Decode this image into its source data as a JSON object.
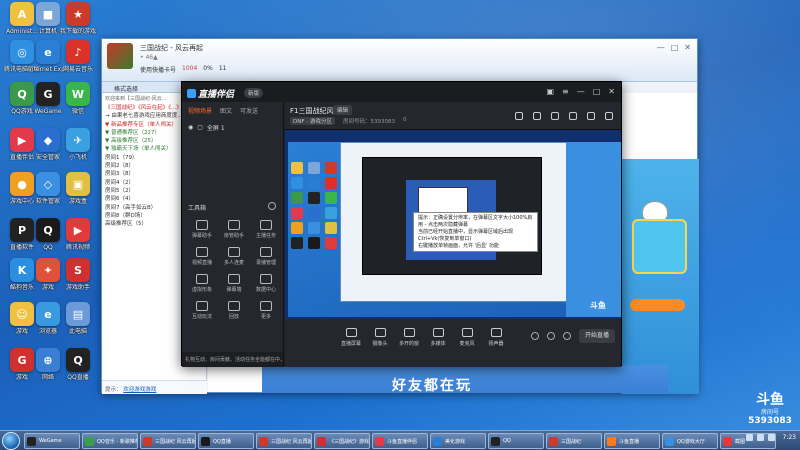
{
  "desktop_icons": [
    {
      "label": "Administ...",
      "color": "#f0c040",
      "glyph": "A"
    },
    {
      "label": "计算机",
      "color": "#7aa6d8",
      "glyph": "■"
    },
    {
      "label": "我下载的游戏",
      "color": "#cc3a2a",
      "glyph": "★"
    },
    {
      "label": "腾讯电脑管家",
      "color": "#2f8fe0",
      "glyph": "◎"
    },
    {
      "label": "Internet Explorer",
      "color": "#2a7fd4",
      "glyph": "e"
    },
    {
      "label": "网易云音乐",
      "color": "#d8322a",
      "glyph": "♪"
    },
    {
      "label": "QQ游戏",
      "color": "#3a9a4a",
      "glyph": "Q"
    },
    {
      "label": "WeGame",
      "color": "#222222",
      "glyph": "G"
    },
    {
      "label": "微信",
      "color": "#3ab54a",
      "glyph": "W"
    },
    {
      "label": "直播伴侣",
      "color": "#e23a4a",
      "glyph": "▶"
    },
    {
      "label": "安全管家",
      "color": "#2a6fd0",
      "glyph": "◆"
    },
    {
      "label": "小飞机",
      "color": "#3aa0e0",
      "glyph": "✈"
    },
    {
      "label": "游戏中心",
      "color": "#f0a020",
      "glyph": "●"
    },
    {
      "label": "软件管家",
      "color": "#3a8fe0",
      "glyph": "◇"
    },
    {
      "label": "游戏盒",
      "color": "#e0c040",
      "glyph": "▣"
    },
    {
      "label": "直播软件",
      "color": "#222222",
      "glyph": "P"
    },
    {
      "label": "QQ",
      "color": "#1a1a1a",
      "glyph": "Q"
    },
    {
      "label": "腾讯视频",
      "color": "#e03a3a",
      "glyph": "▶"
    },
    {
      "label": "酷狗音乐",
      "color": "#2a8fe0",
      "glyph": "K"
    },
    {
      "label": "游戏",
      "color": "#e0503a",
      "glyph": "✦"
    },
    {
      "label": "游戏助手",
      "color": "#d03030",
      "glyph": "S"
    },
    {
      "label": "游戏",
      "color": "#f0c040",
      "glyph": "☺"
    },
    {
      "label": "浏览器",
      "color": "#3a9ae0",
      "glyph": "e"
    },
    {
      "label": "此电脑",
      "color": "#6a9ad8",
      "glyph": "▤"
    },
    {
      "label": "游戏",
      "color": "#d03030",
      "glyph": "G"
    },
    {
      "label": "网络",
      "color": "#3a7fd4",
      "glyph": "⊕"
    },
    {
      "label": "QQ直播",
      "color": "#222222",
      "glyph": "Q"
    }
  ],
  "client": {
    "title": "三国战纪 - 风云再起",
    "status": "• 46▲",
    "stats": [
      "使用快播卡号",
      "1004",
      "0%",
      "11"
    ],
    "tab": "格式选择",
    "welcome": "欢迎来到【三国战纪-风云...",
    "tree": [
      {
        "text": "《三国战纪》《风云在起》《...》",
        "cls": "red"
      },
      {
        "text": "→ 由果老七喜游戏应用商度度...",
        "cls": ""
      },
      {
        "text": "▼ 新品推荐专区（单人闯关）",
        "cls": "red"
      },
      {
        "text": "  ▼ 普通推荐区（227）",
        "cls": "green"
      },
      {
        "text": "  ▼ 高级推荐区（25）",
        "cls": "green"
      },
      {
        "text": "▼ 独霸天下场（单人闯关）",
        "cls": "green"
      },
      {
        "text": "    房间1（79）",
        "cls": ""
      },
      {
        "text": "    房间2（8）",
        "cls": ""
      },
      {
        "text": "    房间3（8）",
        "cls": ""
      },
      {
        "text": "    房间4（2）",
        "cls": ""
      },
      {
        "text": "    房间5（2）",
        "cls": ""
      },
      {
        "text": "    房间6（4）",
        "cls": ""
      },
      {
        "text": "    房间7（高手如云B）",
        "cls": ""
      },
      {
        "text": "    房间8（群D场）",
        "cls": ""
      },
      {
        "text": "    高级推荐区（5）",
        "cls": ""
      }
    ],
    "footer_prefix": "提示",
    "footer_link": "欢迎游戏游戏",
    "promo_bottom": "好友都在玩"
  },
  "companion": {
    "app_name": "直播伴侣",
    "badge": "新版",
    "left_tabs": [
      "视频场景",
      "图文",
      "可发送"
    ],
    "scene_label": "全屏 1",
    "tools_title": "工具箱",
    "tools": [
      "弹幕助手",
      "房管助手",
      "主播任务",
      "视频直播",
      "多人连麦",
      "录播管理",
      "虚拟形象",
      "弹幕墙",
      "数据中心",
      "互动玩法",
      "回放",
      "更多"
    ],
    "footer": "礼物互动、房间贡献、活动任务全能都在中，获得帮助",
    "room_title": "F1三国战纪风大赛",
    "room_tag": "编辑",
    "room_meta": [
      "DNF - 游戏分区",
      "房间号码：5393083",
      "0"
    ],
    "controls": [
      "直播屏幕",
      "摄像头",
      "多开的窗",
      "多媒体",
      "麦克风",
      "扬声器"
    ],
    "start_label": "开始直播",
    "tooltip_lines": [
      "提示：正确设置分辨率，在弹幕区文字大小100%启用 - 点击两次隐藏弹幕",
      "当前已经开始直播中，显示弹幕区域后出现",
      "Ctrl+Vk(恢复到单窗口)",
      "右键播放单帧画面，允许 '后显' 功能"
    ]
  },
  "watermark": {
    "logo": "斗鱼",
    "sub": "房间号",
    "number": "5393083"
  },
  "taskbar": {
    "items": [
      {
        "label": "WeGame",
        "color": "#222222"
      },
      {
        "label": "QQ音乐 - 新歌推荐",
        "color": "#3aa04a"
      },
      {
        "label": "三国战纪 风云再起",
        "color": "#cc3a2a"
      },
      {
        "label": "QQ直播",
        "color": "#1a1a1a"
      },
      {
        "label": "三国战纪 风云再起",
        "color": "#cc3a2a"
      },
      {
        "label": "《三国战纪》游戏",
        "color": "#d03030"
      },
      {
        "label": "斗鱼直播伴侣",
        "color": "#e23a4a"
      },
      {
        "label": "美化游戏",
        "color": "#2a7fd4"
      },
      {
        "label": "QQ",
        "color": "#222222"
      },
      {
        "label": "三国战纪",
        "color": "#cc3a2a"
      },
      {
        "label": "斗鱼直播",
        "color": "#ff7a1a"
      },
      {
        "label": "QQ游戏大厅",
        "color": "#3a8fe0"
      },
      {
        "label": "截图",
        "color": "#e03a3a"
      }
    ],
    "clock": "7:23"
  }
}
